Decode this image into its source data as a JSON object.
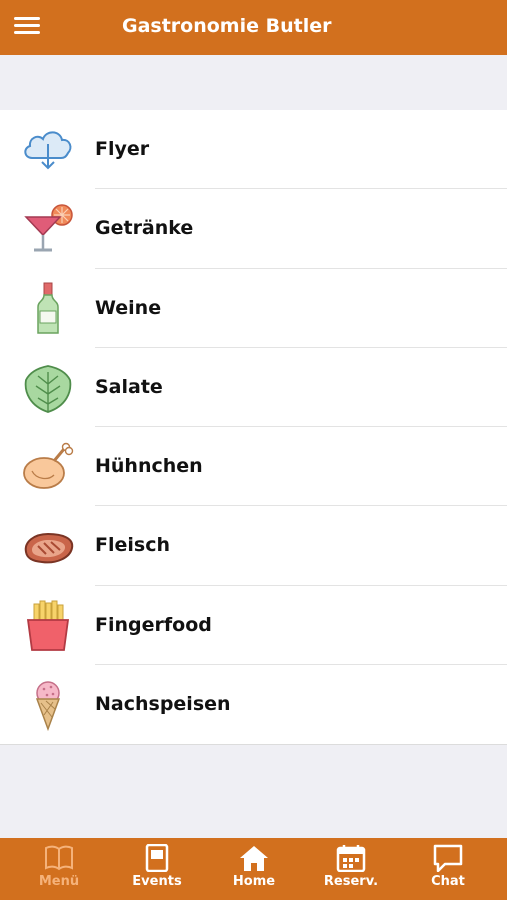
{
  "header": {
    "title": "Gastronomie Butler",
    "menu_icon": "hamburger-icon"
  },
  "menu_items": [
    {
      "label": "Flyer",
      "icon": "cloud-download-icon"
    },
    {
      "label": "Getränke",
      "icon": "cocktail-icon"
    },
    {
      "label": "Weine",
      "icon": "wine-bottle-icon"
    },
    {
      "label": "Salate",
      "icon": "lettuce-icon"
    },
    {
      "label": "Hühnchen",
      "icon": "chicken-leg-icon"
    },
    {
      "label": "Fleisch",
      "icon": "steak-icon"
    },
    {
      "label": "Fingerfood",
      "icon": "fries-icon"
    },
    {
      "label": "Nachspeisen",
      "icon": "ice-cream-icon"
    }
  ],
  "tabbar": {
    "tabs": [
      {
        "label": "Menü",
        "icon": "book-icon",
        "active": true
      },
      {
        "label": "Events",
        "icon": "flyer-icon",
        "active": false
      },
      {
        "label": "Home",
        "icon": "home-icon",
        "active": false
      },
      {
        "label": "Reserv.",
        "icon": "calendar-icon",
        "active": false
      },
      {
        "label": "Chat",
        "icon": "chat-bubble-icon",
        "active": false
      }
    ]
  },
  "colors": {
    "accent": "#d2701e",
    "active_tab": "#f5b27a",
    "background": "#efeff4"
  }
}
